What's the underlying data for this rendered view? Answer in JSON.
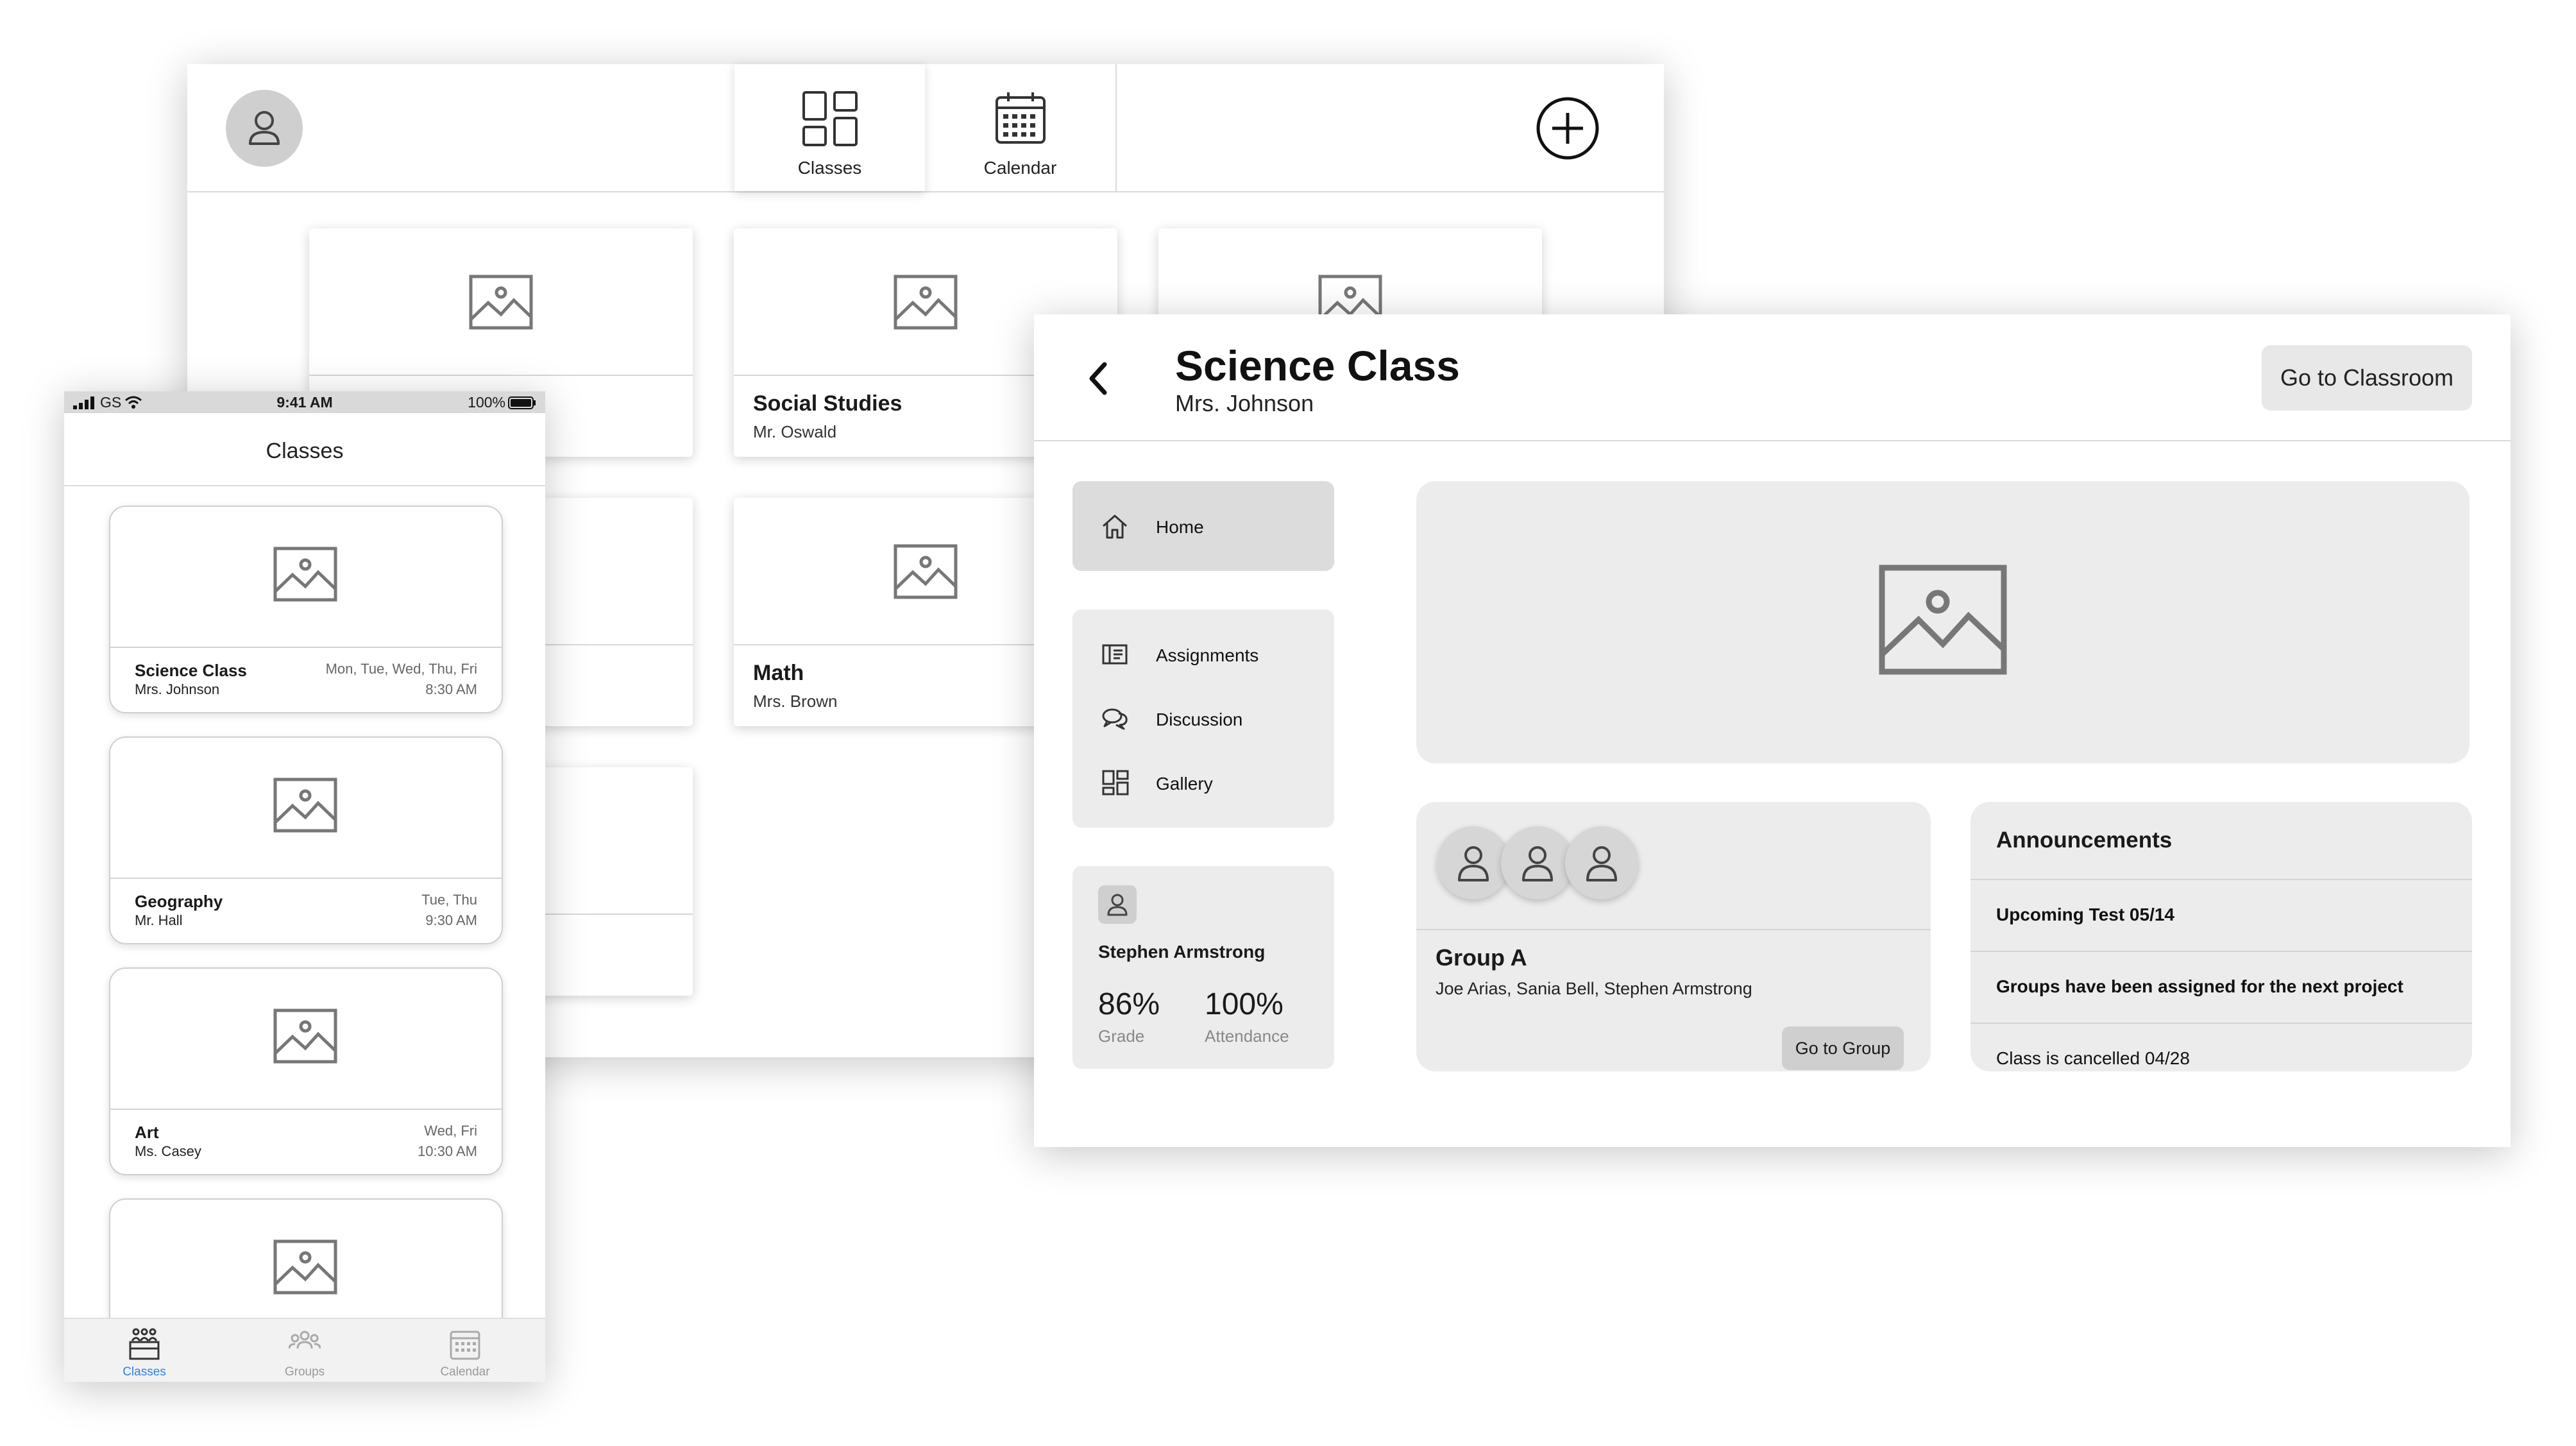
{
  "tablet": {
    "tabs": [
      {
        "label": "Classes",
        "icon": "grid-icon"
      },
      {
        "label": "Calendar",
        "icon": "calendar-icon"
      }
    ],
    "classes": [
      {
        "name": "",
        "teacher": ""
      },
      {
        "name": "Social Studies",
        "teacher": "Mr. Oswald"
      },
      {
        "name": "",
        "teacher": ""
      },
      {
        "name": "",
        "teacher": ""
      },
      {
        "name": "Math",
        "teacher": "Mrs. Brown"
      },
      {
        "name": "",
        "teacher": ""
      }
    ]
  },
  "phone": {
    "status": {
      "carrier": "GS",
      "time": "9:41 AM",
      "battery": "100%"
    },
    "title": "Classes",
    "classes": [
      {
        "name": "Science Class",
        "teacher": "Mrs. Johnson",
        "days": "Mon, Tue, Wed, Thu, Fri",
        "time": "8:30 AM"
      },
      {
        "name": "Geography",
        "teacher": "Mr. Hall",
        "days": "Tue, Thu",
        "time": "9:30 AM"
      },
      {
        "name": "Art",
        "teacher": "Ms. Casey",
        "days": "Wed, Fri",
        "time": "10:30 AM"
      },
      {
        "name": "",
        "teacher": "",
        "days": "",
        "time": ""
      }
    ],
    "tabs": [
      {
        "label": "Classes",
        "active": true
      },
      {
        "label": "Groups",
        "active": false
      },
      {
        "label": "Calendar",
        "active": false
      }
    ],
    "accent_color": "#2f80ed"
  },
  "desktop": {
    "class_title": "Science Class",
    "teacher": "Mrs. Johnson",
    "go_to_classroom": "Go to Classroom",
    "nav": {
      "home": "Home",
      "assignments": "Assignments",
      "discussion": "Discussion",
      "gallery": "Gallery"
    },
    "student": {
      "name": "Stephen Armstrong",
      "grade_value": "86%",
      "grade_label": "Grade",
      "attendance_value": "100%",
      "attendance_label": "Attendance"
    },
    "group": {
      "name": "Group A",
      "members": "Joe Arias, Sania Bell, Stephen Armstrong",
      "button": "Go to Group"
    },
    "announcements": {
      "title": "Announcements",
      "items": [
        {
          "text": "Upcoming Test 05/14",
          "bold": true
        },
        {
          "text": "Groups have been assigned for the next project",
          "bold": true
        },
        {
          "text": "Class is cancelled 04/28",
          "bold": false
        }
      ]
    }
  }
}
